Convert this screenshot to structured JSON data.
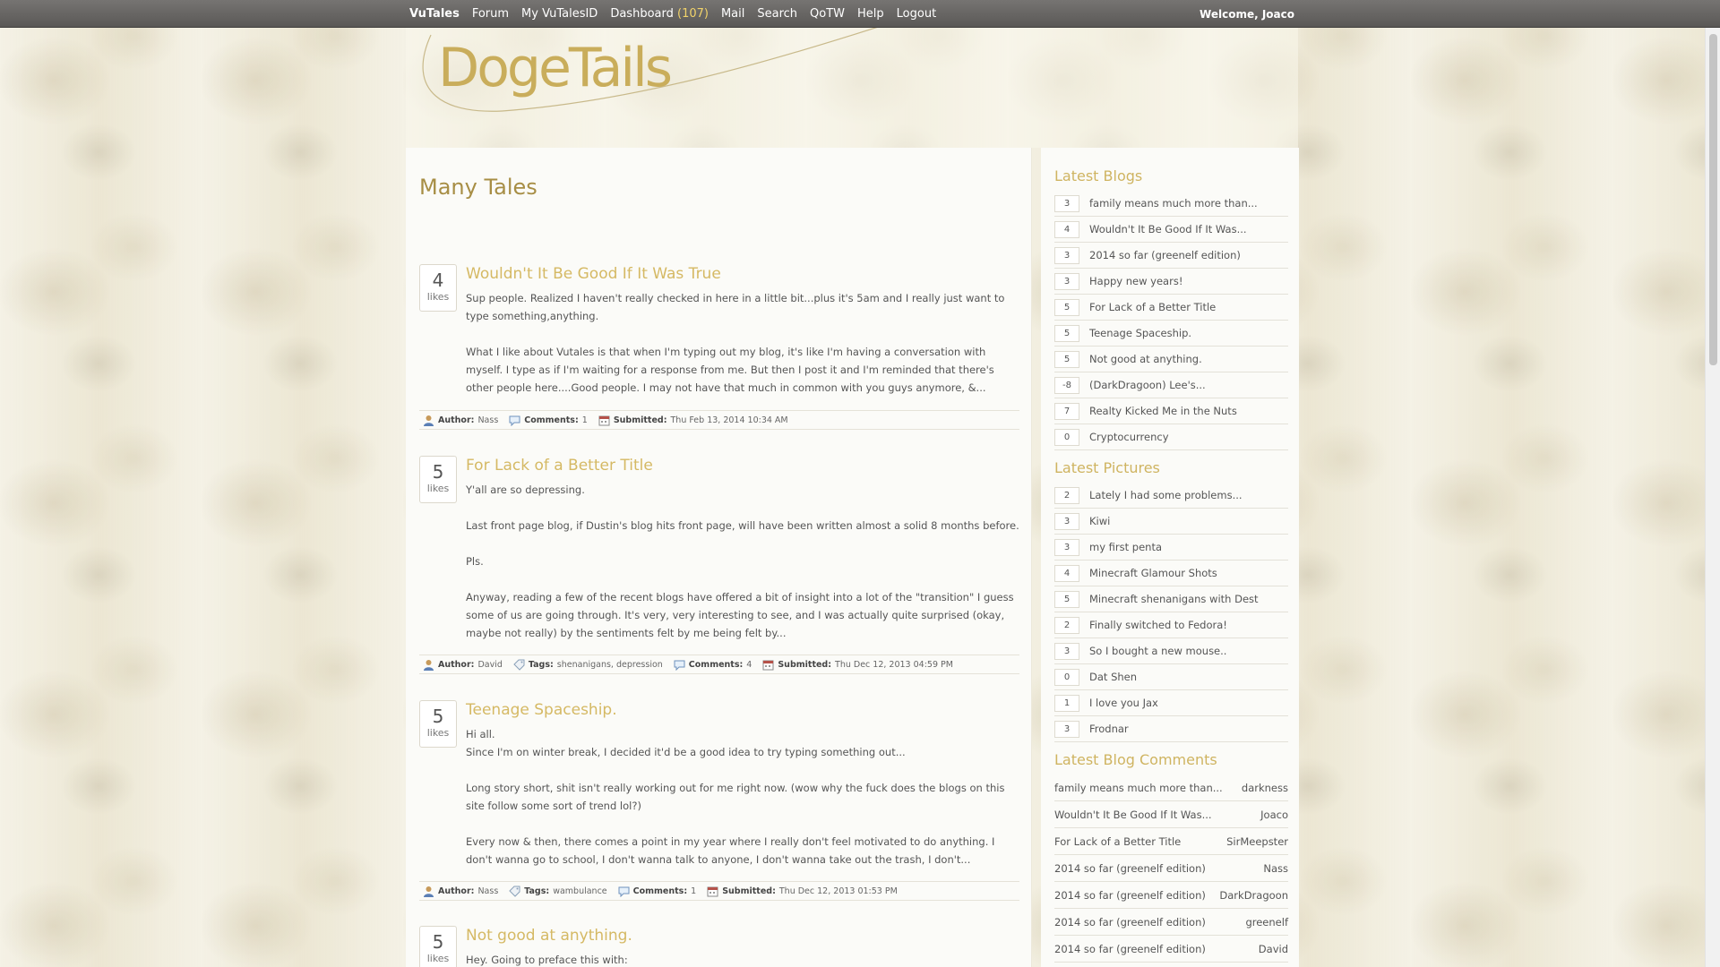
{
  "nav": {
    "brand": "VuTales",
    "items": [
      "Forum",
      "My VuTalesID"
    ],
    "dashboard": "Dashboard",
    "dashboard_count": "(107)",
    "items2": [
      "Mail",
      "Search",
      "QoTW",
      "Help",
      "Logout"
    ],
    "welcome": "Welcome, Joaco"
  },
  "header": {
    "logo": "DogeTails"
  },
  "main": {
    "title": "Many Tales",
    "likes_label": "likes",
    "meta_labels": {
      "author": "Author:",
      "tags": "Tags:",
      "comments": "Comments:",
      "submitted": "Submitted:"
    },
    "posts": [
      {
        "likes": "4",
        "title": "Wouldn't It Be Good If It Was True",
        "paragraphs": [
          "Sup people. Realized I haven't really checked in here in a little bit...plus it's 5am and I really just want to type something,anything.",
          "What I like about Vutales is that when I'm typing out my blog, it's like I'm having a conversation with myself. I type as if I'm waiting for a response from me. But then I post it and I'm reminded that there's other people here....Good people. I may not have that much in common with you guys anymore, &..."
        ],
        "author": "Nass",
        "tags": "",
        "comments": "1",
        "submitted": "Thu Feb 13, 2014 10:34 AM"
      },
      {
        "likes": "5",
        "title": "For Lack of a Better Title",
        "paragraphs": [
          "Y'all are so depressing.",
          "Last front page blog, if Dustin's blog hits front page, will have been written almost a solid 8 months before.",
          "Pls.",
          "Anyway, reading a few of the recent blogs have offered a bit of insight into a lot of the \"transition\" I guess some of us are going through. It's very, very interesting to see, and I was actually quite surprised (okay, maybe not really) by the sentiments felt by me being felt by..."
        ],
        "author": "David",
        "tags": "shenanigans, depression",
        "comments": "4",
        "submitted": "Thu Dec 12, 2013 04:59 PM"
      },
      {
        "likes": "5",
        "title": "Teenage Spaceship.",
        "paragraphs": [
          "Hi all.",
          "Since I'm on winter break, I decided it'd be a good idea to try typing something out...",
          "Long story short, shit isn't really working out for me right now. (wow why the fuck does the blogs on this site follow some sort of trend lol?)",
          "Every now & then, there comes a point in my year where I really don't feel motivated to do anything. I don't wanna go to school, I don't wanna talk to anyone, I don't wanna take out the trash, I don't..."
        ],
        "author": "Nass",
        "tags": "wambulance",
        "comments": "1",
        "submitted": "Thu Dec 12, 2013 01:53 PM"
      },
      {
        "likes": "5",
        "title": "Not good at anything.",
        "paragraphs": [
          "Hey. Going to preface this with:"
        ]
      }
    ]
  },
  "sidebar": {
    "latest_blogs_title": "Latest Blogs",
    "latest_blogs": [
      {
        "count": "3",
        "title": "family means much more than..."
      },
      {
        "count": "4",
        "title": "Wouldn't It Be Good If It Was..."
      },
      {
        "count": "3",
        "title": "2014 so far (greenelf edition)"
      },
      {
        "count": "3",
        "title": "Happy new years!"
      },
      {
        "count": "5",
        "title": "For Lack of a Better Title"
      },
      {
        "count": "5",
        "title": "Teenage Spaceship."
      },
      {
        "count": "5",
        "title": "Not good at anything."
      },
      {
        "count": "-8",
        "title": "(DarkDragoon) Lee's..."
      },
      {
        "count": "7",
        "title": "Realty Kicked Me in the Nuts"
      },
      {
        "count": "0",
        "title": "Cryptocurrency"
      }
    ],
    "latest_pictures_title": "Latest Pictures",
    "latest_pictures": [
      {
        "count": "2",
        "title": "Lately I had some problems..."
      },
      {
        "count": "3",
        "title": "Kiwi"
      },
      {
        "count": "3",
        "title": "my first penta"
      },
      {
        "count": "4",
        "title": "Minecraft Glamour Shots"
      },
      {
        "count": "5",
        "title": "Minecraft shenanigans with Dest"
      },
      {
        "count": "2",
        "title": "Finally switched to Fedora!"
      },
      {
        "count": "3",
        "title": "So I bought a new mouse.."
      },
      {
        "count": "0",
        "title": "Dat Shen"
      },
      {
        "count": "1",
        "title": "I love you Jax"
      },
      {
        "count": "3",
        "title": "Frodnar"
      }
    ],
    "latest_comments_title": "Latest Blog Comments",
    "latest_comments": [
      {
        "title": "family means much more than...",
        "user": "darkness"
      },
      {
        "title": "Wouldn't It Be Good If It Was...",
        "user": "Joaco"
      },
      {
        "title": "For Lack of a Better Title",
        "user": "SirMeepster"
      },
      {
        "title": "2014 so far (greenelf edition)",
        "user": "Nass"
      },
      {
        "title": "2014 so far (greenelf edition)",
        "user": "DarkDragoon"
      },
      {
        "title": "2014 so far (greenelf edition)",
        "user": "greenelf"
      },
      {
        "title": "2014 so far (greenelf edition)",
        "user": "David"
      }
    ]
  }
}
